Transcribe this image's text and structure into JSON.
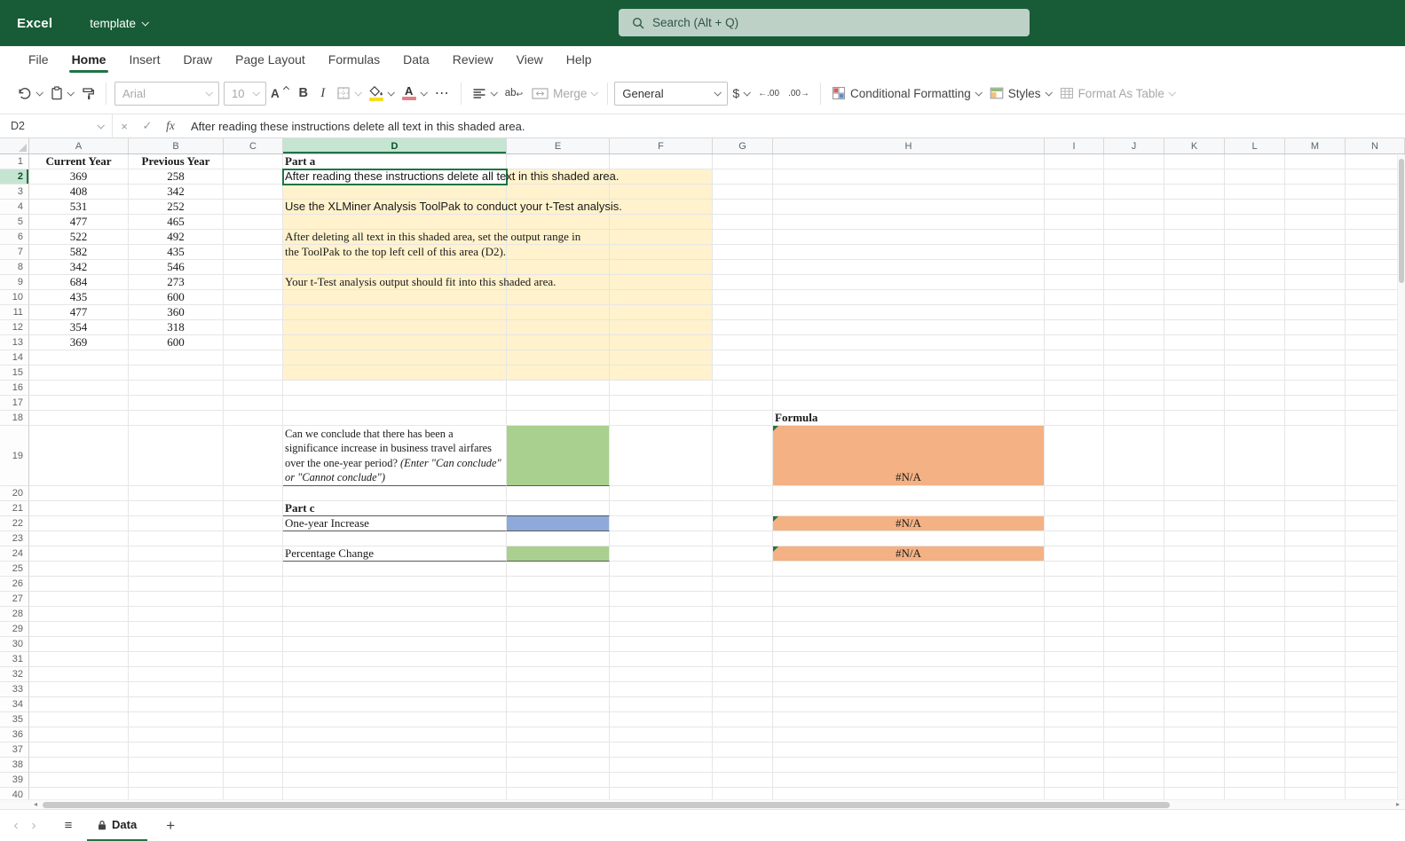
{
  "titlebar": {
    "app_name": "Excel",
    "document_name": "template",
    "search_placeholder": "Search (Alt + Q)"
  },
  "menubar": {
    "items": [
      "File",
      "Home",
      "Insert",
      "Draw",
      "Page Layout",
      "Formulas",
      "Data",
      "Review",
      "View",
      "Help"
    ],
    "active_item": "Home"
  },
  "toolbar": {
    "font_name": "Arial",
    "font_size": "10",
    "merge_label": "Merge",
    "number_format": "General",
    "conditional_formatting_label": "Conditional Formatting",
    "styles_label": "Styles",
    "format_as_table_label": "Format As Table"
  },
  "icons": {
    "increase_font": "A",
    "bold": "B",
    "italic": "I",
    "more": "⋯",
    "wrap": "ab",
    "wrap_arrow": "↩",
    "dollar": "$",
    "decrease_decimal": "←.00",
    "increase_decimal": ".00→",
    "close": "×",
    "check": "✓",
    "fx": "fx",
    "prev_sheet": "‹",
    "next_sheet": "›",
    "sheet_menu": "≡",
    "add_sheet": "+",
    "hscroll_left": "◂",
    "hscroll_right": "▸"
  },
  "formula_bar": {
    "name_box": "D2",
    "formula": "After reading these instructions delete all text in this shaded area."
  },
  "grid": {
    "column_headers": [
      "A",
      "B",
      "C",
      "D",
      "E",
      "F",
      "G",
      "H",
      "I",
      "J",
      "K",
      "L",
      "M",
      "N"
    ],
    "row_count": 40,
    "selection": {
      "cell": "D2",
      "col": "D",
      "row": 2
    },
    "shaded_area": {
      "cols": [
        "D",
        "E",
        "F"
      ],
      "from_row": 2,
      "to_row": 15,
      "color": "#FFF2CC"
    },
    "cells": [
      {
        "a": "A1",
        "t": "Current Year",
        "cls": "th"
      },
      {
        "a": "B1",
        "t": "Previous Year",
        "cls": "th"
      },
      {
        "a": "D1",
        "t": "Part a",
        "cls": "part"
      },
      {
        "a": "A2",
        "t": "369",
        "cls": "num"
      },
      {
        "a": "B2",
        "t": "258",
        "cls": "num"
      },
      {
        "a": "A3",
        "t": "408",
        "cls": "num"
      },
      {
        "a": "B3",
        "t": "342",
        "cls": "num"
      },
      {
        "a": "A4",
        "t": "531",
        "cls": "num"
      },
      {
        "a": "B4",
        "t": "252",
        "cls": "num"
      },
      {
        "a": "A5",
        "t": "477",
        "cls": "num"
      },
      {
        "a": "B5",
        "t": "465",
        "cls": "num"
      },
      {
        "a": "A6",
        "t": "522",
        "cls": "num"
      },
      {
        "a": "B6",
        "t": "492",
        "cls": "num"
      },
      {
        "a": "A7",
        "t": "582",
        "cls": "num"
      },
      {
        "a": "B7",
        "t": "435",
        "cls": "num"
      },
      {
        "a": "A8",
        "t": "342",
        "cls": "num"
      },
      {
        "a": "B8",
        "t": "546",
        "cls": "num"
      },
      {
        "a": "A9",
        "t": "684",
        "cls": "num"
      },
      {
        "a": "B9",
        "t": "273",
        "cls": "num"
      },
      {
        "a": "A10",
        "t": "435",
        "cls": "num"
      },
      {
        "a": "B10",
        "t": "600",
        "cls": "num"
      },
      {
        "a": "A11",
        "t": "477",
        "cls": "num"
      },
      {
        "a": "B11",
        "t": "360",
        "cls": "num"
      },
      {
        "a": "A12",
        "t": "354",
        "cls": "num"
      },
      {
        "a": "B12",
        "t": "318",
        "cls": "num"
      },
      {
        "a": "A13",
        "t": "369",
        "cls": "num"
      },
      {
        "a": "B13",
        "t": "600",
        "cls": "num"
      },
      {
        "a": "D2",
        "t": "After reading these instructions delete all text in this shaded area.",
        "cls": "s",
        "bg": "#FFFFFF"
      },
      {
        "a": "D4",
        "t": "Use the XLMiner Analysis ToolPak to conduct your t-Test analysis.",
        "cls": "s"
      },
      {
        "a": "D6",
        "t": "After deleting all text in this shaded area, set the output range in",
        "cls": "sf"
      },
      {
        "a": "D7",
        "t": "the ToolPak to the top left cell of this area (D2).",
        "cls": "sf"
      },
      {
        "a": "D9",
        "t": "Your t-Test analysis output should fit into this shaded area.",
        "cls": "sf"
      },
      {
        "a": "H18",
        "t": "Formula",
        "cls": "part"
      },
      {
        "a": "D19",
        "cls": "q bb",
        "parts": [
          {
            "t": "Can we conclude that there has been a significance increase in business travel airfares over the one-year period? ",
            "i": false
          },
          {
            "t": "(Enter \"Can conclude\" or \"Cannot conclude\")",
            "i": true
          }
        ]
      },
      {
        "a": "E19",
        "bg": "#A9D08E",
        "cls": "bb"
      },
      {
        "a": "H19",
        "t": "#N/A",
        "cls": "nab",
        "bg": "#F4B183",
        "marker": true
      },
      {
        "a": "D21",
        "t": "Part c",
        "cls": "part bb"
      },
      {
        "a": "E21",
        "cls": "bb"
      },
      {
        "a": "D22",
        "t": "One-year Increase",
        "cls": "bb"
      },
      {
        "a": "E22",
        "bg": "#8EAADB",
        "cls": "bb"
      },
      {
        "a": "H22",
        "t": "#N/A",
        "cls": "na",
        "bg": "#F4B183",
        "marker": true
      },
      {
        "a": "D24",
        "t": "Percentage Change",
        "cls": "bb"
      },
      {
        "a": "E24",
        "bg": "#A9D08E",
        "cls": "bb"
      },
      {
        "a": "H24",
        "t": "#N/A",
        "cls": "na",
        "bg": "#F4B183",
        "marker": true
      }
    ]
  },
  "sheetbar": {
    "sheet_name": "Data"
  },
  "colors": {
    "titlebar_green": "#185C37",
    "selection_green": "#217346",
    "shaded_area_yellow": "#FFF2CC",
    "green_cell": "#A9D08E",
    "blue_cell": "#8EAADB",
    "orange_cell": "#F4B183"
  }
}
